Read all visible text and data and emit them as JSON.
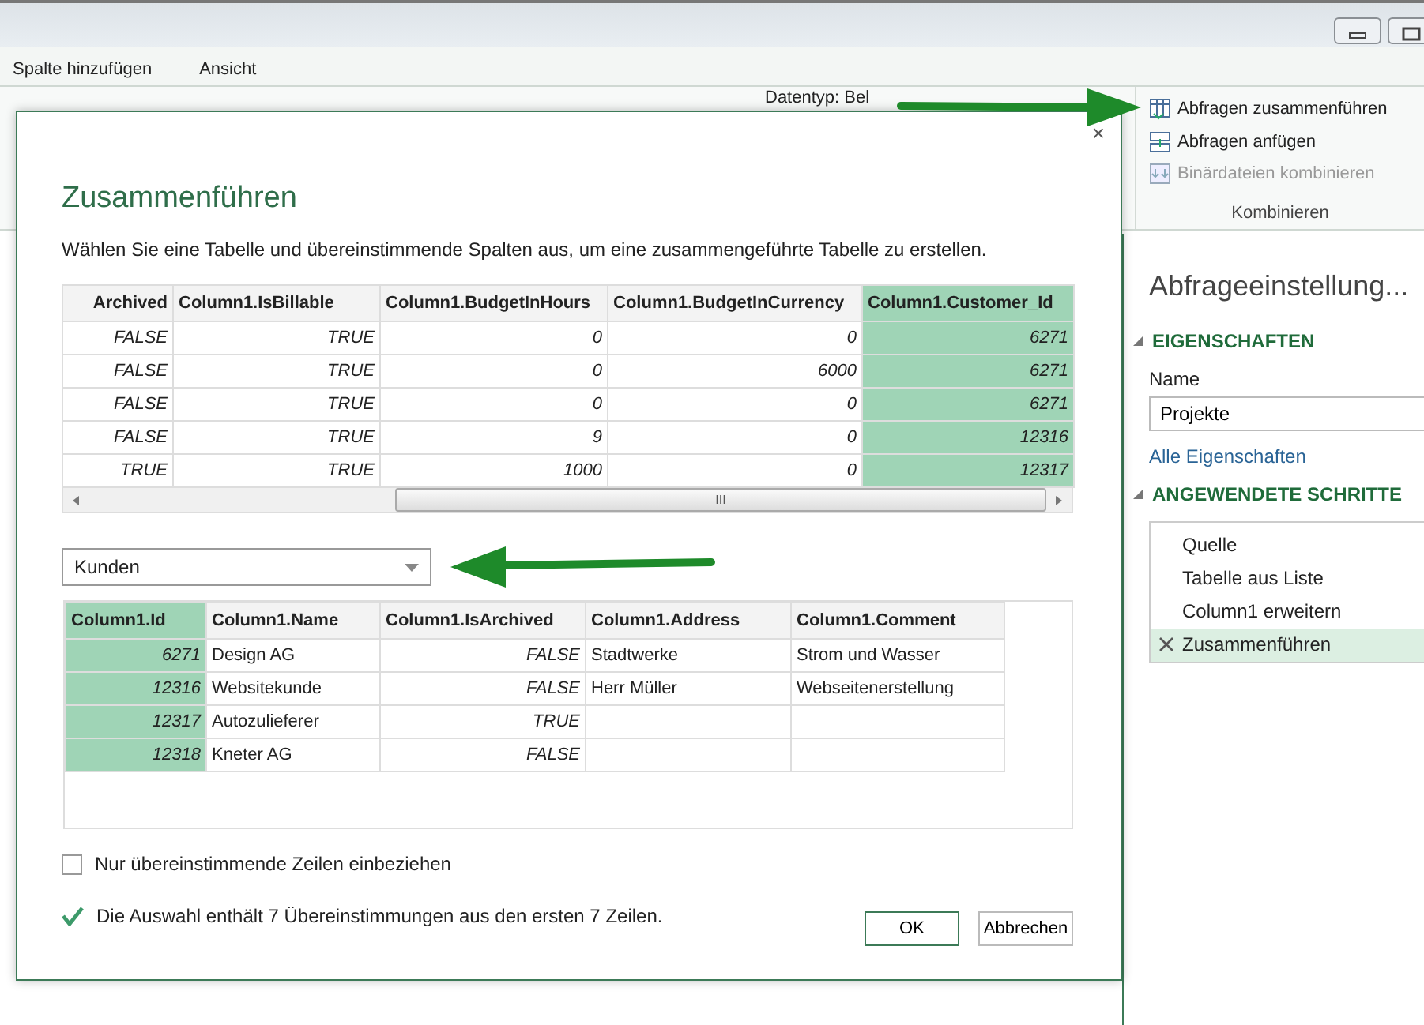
{
  "ribbon_tabs": [
    {
      "label": "Spalte hinzufügen"
    },
    {
      "label": "Ansicht"
    }
  ],
  "ribbon": {
    "datatype_label": "Datentyp: Bel",
    "group": {
      "label": "Kombinieren",
      "buttons": [
        {
          "label": "Abfragen zusammenführen",
          "kind": "merge",
          "disabled": false
        },
        {
          "label": "Abfragen anfügen",
          "kind": "append",
          "disabled": false
        },
        {
          "label": "Binärdateien kombinieren",
          "kind": "binary",
          "disabled": true
        }
      ]
    }
  },
  "settings_pane": {
    "title": "Abfrageeinstellung...",
    "properties_heading": "EIGENSCHAFTEN",
    "name_label": "Name",
    "name_value": "Projekte",
    "all_properties_link": "Alle Eigenschaften",
    "steps_heading": "ANGEWENDETE SCHRITTE",
    "steps": [
      {
        "label": "Quelle",
        "selected": false
      },
      {
        "label": "Tabelle aus Liste",
        "selected": false
      },
      {
        "label": "Column1 erweitern",
        "selected": false
      },
      {
        "label": "Zusammenführen",
        "selected": true
      }
    ]
  },
  "dialog": {
    "close": "×",
    "title": "Zusammenführen",
    "description": "Wählen Sie eine Tabelle und übereinstimmende Spalten aus, um eine zusammengeführte Tabelle zu erstellen.",
    "top_table": {
      "columns": [
        {
          "label": "Archived",
          "kind": "number",
          "selected": false
        },
        {
          "label": "Column1.IsBillable",
          "kind": "number",
          "selected": false
        },
        {
          "label": "Column1.BudgetInHours",
          "kind": "number",
          "selected": false
        },
        {
          "label": "Column1.BudgetInCurrency",
          "kind": "number",
          "selected": false
        },
        {
          "label": "Column1.Customer_Id",
          "kind": "number",
          "selected": true
        }
      ],
      "rows": [
        [
          "FALSE",
          "TRUE",
          "0",
          "0",
          "6271"
        ],
        [
          "FALSE",
          "TRUE",
          "0",
          "6000",
          "6271"
        ],
        [
          "FALSE",
          "TRUE",
          "0",
          "0",
          "6271"
        ],
        [
          "FALSE",
          "TRUE",
          "9",
          "0",
          "12316"
        ],
        [
          "TRUE",
          "TRUE",
          "1000",
          "0",
          "12317"
        ]
      ],
      "scroll_grip": "III"
    },
    "table_select": {
      "value": "Kunden"
    },
    "bottom_table": {
      "columns": [
        {
          "label": "Column1.Id",
          "kind": "number",
          "selected": true
        },
        {
          "label": "Column1.Name",
          "kind": "text",
          "selected": false
        },
        {
          "label": "Column1.IsArchived",
          "kind": "number",
          "selected": false
        },
        {
          "label": "Column1.Address",
          "kind": "text",
          "selected": false
        },
        {
          "label": "Column1.Comment",
          "kind": "text",
          "selected": false
        }
      ],
      "rows": [
        [
          "6271",
          "Design AG",
          "FALSE",
          "Stadtwerke",
          "Strom und Wasser"
        ],
        [
          "12316",
          "Websitekunde",
          "FALSE",
          "Herr Müller",
          "Webseitenerstellung"
        ],
        [
          "12317",
          "Autozulieferer",
          "TRUE",
          "",
          ""
        ],
        [
          "12318",
          "Kneter AG",
          "FALSE",
          "",
          ""
        ]
      ]
    },
    "matching_only": {
      "label": "Nur übereinstimmende Zeilen einbeziehen",
      "checked": false
    },
    "status": "Die Auswahl enthält 7 Übereinstimmungen aus den ersten 7 Zeilen.",
    "buttons": [
      {
        "label": "OK",
        "kind": "primary"
      },
      {
        "label": "Abbrechen",
        "kind": "secondary"
      }
    ]
  }
}
